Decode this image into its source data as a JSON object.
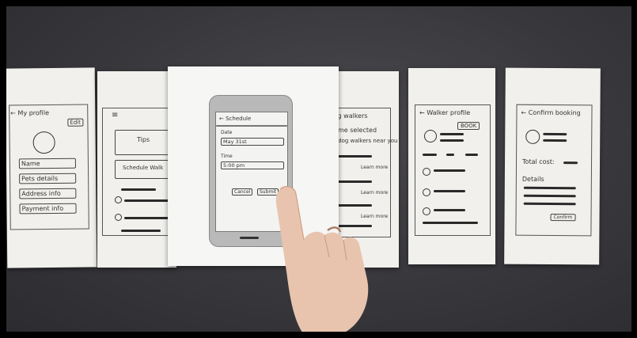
{
  "sheets": {
    "my_profile": {
      "title": "← My profile",
      "edit": "Edit",
      "fields": [
        "Name",
        "Pets details",
        "Address info",
        "Payment info"
      ]
    },
    "home": {
      "menu": "≡",
      "tips": "Tips",
      "schedule_walk": "Schedule Walk"
    },
    "schedule": {
      "title": "← Schedule",
      "date_label": "Date",
      "date_value": "May 31st",
      "time_label": "Time",
      "time_value": "5:00 pm",
      "cancel": "Cancel",
      "submit": "Submit"
    },
    "walkers": {
      "title": "...og walkers",
      "time_selected": "...time selected",
      "available": "...e dog walkers near you",
      "learn_more": [
        "Learn more",
        "Learn more",
        "Learn more"
      ]
    },
    "walker_profile": {
      "title": "← Walker profile",
      "book": "BOOK"
    },
    "confirm_booking": {
      "title": "← Confirm booking",
      "total_cost": "Total cost:",
      "details": "Details",
      "confirm": "Confirm"
    }
  }
}
